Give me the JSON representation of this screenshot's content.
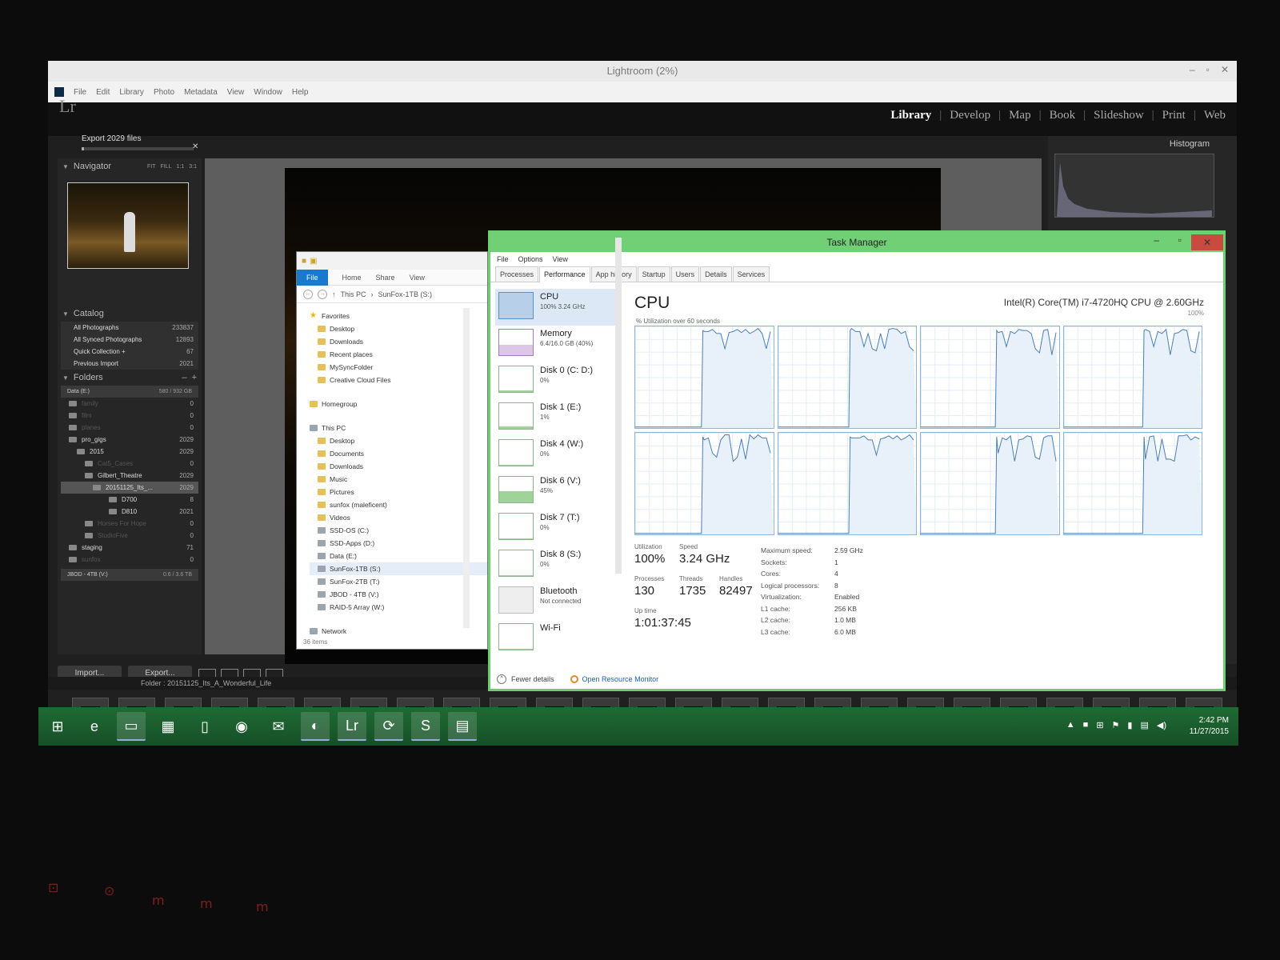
{
  "lightroom": {
    "title": "Lightroom (2%)",
    "logo": "Lr",
    "menu": [
      "File",
      "Edit",
      "Library",
      "Photo",
      "Metadata",
      "View",
      "Window",
      "Help"
    ],
    "export_status": "Export 2029 files",
    "export_progress": 0.02,
    "modules": [
      "Library",
      "Develop",
      "Map",
      "Book",
      "Slideshow",
      "Print",
      "Web"
    ],
    "active_module": "Library",
    "navigator": {
      "label": "Navigator",
      "modes": [
        "FIT",
        "FILL",
        "1:1",
        "3:1"
      ]
    },
    "catalog": {
      "label": "Catalog",
      "items": [
        {
          "label": "All Photographs",
          "count": "233837"
        },
        {
          "label": "All Synced Photographs",
          "count": "12893"
        },
        {
          "label": "Quick Collection +",
          "count": "67"
        },
        {
          "label": "Previous Import",
          "count": "2021"
        }
      ]
    },
    "folders": {
      "label": "Folders",
      "volume": {
        "label": "Data (E:)",
        "size": "580 / 932 GB"
      },
      "items": [
        {
          "label": "family",
          "count": "0",
          "dim": true
        },
        {
          "label": "film",
          "count": "0",
          "dim": true
        },
        {
          "label": "planes",
          "count": "0",
          "dim": true
        },
        {
          "label": "pro_gigs",
          "count": "2029",
          "dim": false
        },
        {
          "label": "2015",
          "count": "2029",
          "dim": false
        },
        {
          "label": "Cat5_Cases",
          "count": "0",
          "dim": true
        },
        {
          "label": "Gilbert_Theatre",
          "count": "2029",
          "dim": false
        },
        {
          "label": "20151125_Its_...",
          "count": "2029",
          "dim": false,
          "selected": true
        },
        {
          "label": "D700",
          "count": "8",
          "dim": false
        },
        {
          "label": "D810",
          "count": "2021",
          "dim": false
        },
        {
          "label": "Horses For Hope",
          "count": "0",
          "dim": true
        },
        {
          "label": "StudioFive",
          "count": "0",
          "dim": true
        },
        {
          "label": "staging",
          "count": "71",
          "dim": false
        },
        {
          "label": "sunfox",
          "count": "0",
          "dim": true
        }
      ],
      "volume2": {
        "label": "JBOD - 4TB (V:)",
        "size": "0.6 / 3.6 TB"
      }
    },
    "import_label": "Import...",
    "export_label": "Export...",
    "histogram_label": "Histogram",
    "filmstrip_path": "Folder : 20151125_Its_A_Wonderful_Life"
  },
  "explorer": {
    "ribbon": [
      "File",
      "Home",
      "Share",
      "View"
    ],
    "breadcrumb": [
      "This PC",
      "SunFox-1TB (S:)"
    ],
    "favorites_label": "Favorites",
    "favorites": [
      "Desktop",
      "Downloads",
      "Recent places",
      "MySyncFolder",
      "Creative Cloud Files"
    ],
    "homegroup_label": "Homegroup",
    "thispc_label": "This PC",
    "thispc_items": [
      "Desktop",
      "Documents",
      "Downloads",
      "Music",
      "Pictures",
      "sunfox (maleficent)",
      "Videos"
    ],
    "drives": [
      "SSD-OS (C:)",
      "SSD-Apps (D:)",
      "Data (E:)",
      "SunFox-1TB (S:)",
      "SunFox-2TB (T:)",
      "JBOD - 4TB (V:)",
      "RAID-5 Array (W:)"
    ],
    "network_label": "Network",
    "status": "36 items"
  },
  "taskmgr": {
    "title": "Task Manager",
    "menu": [
      "File",
      "Options",
      "View"
    ],
    "tabs": [
      "Processes",
      "Performance",
      "App history",
      "Startup",
      "Users",
      "Details",
      "Services"
    ],
    "active_tab": "Performance",
    "resources": [
      {
        "name": "CPU",
        "sub": "100% 3.24 GHz",
        "kind": "cpu",
        "level": 1.0
      },
      {
        "name": "Memory",
        "sub": "6.4/16.0 GB (40%)",
        "kind": "mem",
        "level": 0.4
      },
      {
        "name": "Disk 0 (C: D:)",
        "sub": "0%",
        "kind": "disk",
        "level": 0.05
      },
      {
        "name": "Disk 1 (E:)",
        "sub": "1%",
        "kind": "disk",
        "level": 0.08
      },
      {
        "name": "Disk 4 (W:)",
        "sub": "0%",
        "kind": "disk",
        "level": 0.0
      },
      {
        "name": "Disk 6 (V:)",
        "sub": "45%",
        "kind": "disk",
        "level": 0.45
      },
      {
        "name": "Disk 7 (T:)",
        "sub": "0%",
        "kind": "disk",
        "level": 0.0
      },
      {
        "name": "Disk 8 (S:)",
        "sub": "0%",
        "kind": "disk",
        "level": 0.0
      },
      {
        "name": "Bluetooth",
        "sub": "Not connected",
        "kind": "bt",
        "level": 0.0
      },
      {
        "name": "Wi-Fi",
        "sub": "",
        "kind": "disk",
        "level": 0.0
      }
    ],
    "heading": "CPU",
    "model": "Intel(R) Core(TM) i7-4720HQ CPU @ 2.60GHz",
    "util_label": "% Utilization over 60 seconds",
    "util_max": "100%",
    "stats": {
      "utilization_label": "Utilization",
      "utilization": "100%",
      "speed_label": "Speed",
      "speed": "3.24 GHz",
      "processes_label": "Processes",
      "processes": "130",
      "threads_label": "Threads",
      "threads": "1735",
      "handles_label": "Handles",
      "handles": "82497",
      "uptime_label": "Up time",
      "uptime": "1:01:37:45"
    },
    "specs": [
      {
        "k": "Maximum speed:",
        "v": "2.59 GHz"
      },
      {
        "k": "Sockets:",
        "v": "1"
      },
      {
        "k": "Cores:",
        "v": "4"
      },
      {
        "k": "Logical processors:",
        "v": "8"
      },
      {
        "k": "Virtualization:",
        "v": "Enabled"
      },
      {
        "k": "L1 cache:",
        "v": "256 KB"
      },
      {
        "k": "L2 cache:",
        "v": "1.0 MB"
      },
      {
        "k": "L3 cache:",
        "v": "6.0 MB"
      }
    ],
    "fewer_details": "Fewer details",
    "open_resmon": "Open Resource Monitor"
  },
  "taskbar": {
    "apps": [
      "windows-start",
      "internet-explorer",
      "file-explorer",
      "store",
      "notepad",
      "chrome",
      "thunderbird",
      "firefox",
      "lightroom",
      "sync",
      "skype",
      "photos"
    ],
    "time": "2:42 PM",
    "date": "11/27/2015"
  },
  "colors": {
    "taskmgr_accent": "#6ecf72",
    "cpu_line": "#4a7fb5",
    "taskbar": "#1f6b33",
    "explorer_file_tab": "#1979ca"
  }
}
